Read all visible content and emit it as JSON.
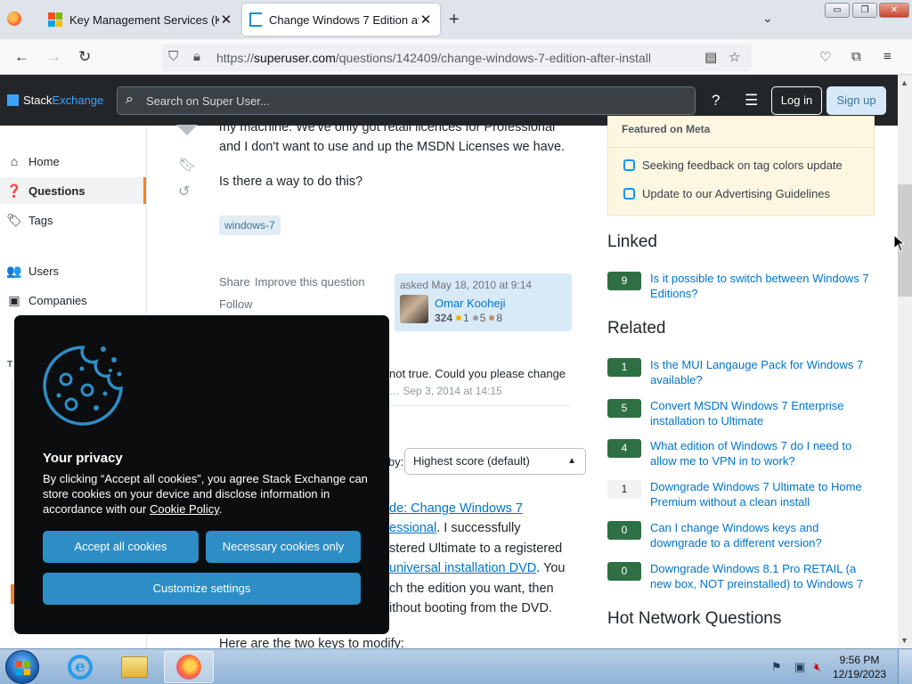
{
  "browser": {
    "tabs": [
      {
        "title": "Key Management Services (KMS",
        "close": "✕"
      },
      {
        "title": "Change Windows 7 Edition afte",
        "close": "✕"
      }
    ],
    "new_tab": "+",
    "url_prefix": "https://",
    "url_domain": "superuser.com",
    "url_path": "/questions/142409/change-windows-7-edition-after-install",
    "window_controls": [
      "▭",
      "❐",
      "✕"
    ]
  },
  "se_header": {
    "logo_stack": "Stack",
    "logo_exchange": "Exchange",
    "search_placeholder": "Search on Super User...",
    "login": "Log in",
    "signup": "Sign up"
  },
  "leftnav": {
    "items": [
      {
        "label": "Home",
        "icon": "⌂"
      },
      {
        "label": "Questions",
        "icon": "❓"
      },
      {
        "label": "Tags",
        "icon": "🏷"
      },
      {
        "label": "Users",
        "icon": "👥"
      },
      {
        "label": "Companies",
        "icon": "▣"
      }
    ]
  },
  "question": {
    "line1": "my machine. We've only got retail licences for Professional",
    "line2": "and I don't want to use and up the MSDN Licenses we have.",
    "line3": "Is there a way to do this?",
    "tag": "windows-7",
    "share": "Share",
    "improve": "Improve this question",
    "follow": "Follow",
    "asked": "asked May 18, 2010 at 9:14",
    "user": "Omar Kooheji",
    "rep": "324",
    "gold": "1",
    "silver": "5",
    "bronze": "8"
  },
  "comment": {
    "text": "not true. Could you please change",
    "meta": "… Sep 3, 2014 at 14:15"
  },
  "sort": {
    "label": "by:",
    "value": "Highest score (default)"
  },
  "answer": {
    "l1a": "de: Change Windows 7",
    "l2a": "essional",
    "l2b": ". I successfully",
    "l3": "stered Ultimate to a registered",
    "l4a": "universal installation DVD",
    "l4b": ". You",
    "l5": "ch the edition you want, then",
    "l6": "ithout booting from the DVD.",
    "l7": "Here are the two keys to modify:"
  },
  "meta_box": {
    "header": "Featured on Meta",
    "items": [
      "Seeking feedback on tag colors update",
      "Update to our Advertising Guidelines"
    ]
  },
  "linked": {
    "title": "Linked",
    "items": [
      {
        "score": "9",
        "text1": "Is it possible to switch between Windows 7",
        "text2": "Editions?"
      }
    ]
  },
  "related": {
    "title": "Related",
    "items": [
      {
        "score": "1",
        "text1": "Is the MUI Langauge Pack for Windows 7",
        "text2": "available?",
        "answered": true
      },
      {
        "score": "5",
        "text1": "Convert MSDN Windows 7 Enterprise",
        "text2": "installation to Ultimate",
        "answered": true
      },
      {
        "score": "4",
        "text1": "What edition of Windows 7 do I need to",
        "text2": "allow me to VPN in to work?",
        "answered": true
      },
      {
        "score": "1",
        "text1": "Downgrade Windows 7 Ultimate to Home",
        "text2": "Premium without a clean install",
        "answered": false
      },
      {
        "score": "0",
        "text1": "Can I change Windows keys and",
        "text2": "downgrade to a different version?",
        "answered": true
      },
      {
        "score": "0",
        "text1": "Downgrade Windows 8.1 Pro RETAIL (a",
        "text2": "new box, NOT preinstalled) to Windows 7",
        "answered": true
      }
    ]
  },
  "hot_network": {
    "title": "Hot Network Questions"
  },
  "cookie": {
    "title": "Your privacy",
    "text_before": "By clicking “Accept all cookies”, you agree Stack Exchange can store cookies on your device and disclose information in accordance with our ",
    "policy_link": "Cookie Policy",
    "text_after": ".",
    "accept": "Accept all cookies",
    "necessary": "Necessary cookies only",
    "customize": "Customize settings"
  },
  "taskbar": {
    "time": "9:56 PM",
    "date": "12/19/2023",
    "ie_glyph": "e"
  }
}
